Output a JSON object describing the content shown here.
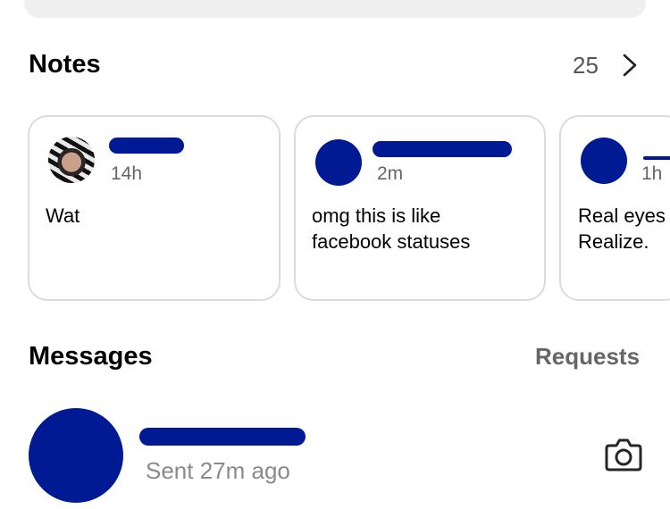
{
  "notes": {
    "title": "Notes",
    "count": "25",
    "cards": [
      {
        "time": "14h",
        "text": "Wat"
      },
      {
        "time": "2m",
        "text": "omg this is like\nfacebook statuses"
      },
      {
        "time": "1h",
        "text": "Real eyes\nRealize."
      }
    ]
  },
  "messages": {
    "title": "Messages",
    "requests_label": "Requests",
    "threads": [
      {
        "status": "Sent 27m ago"
      }
    ]
  },
  "icons": {
    "notes_more": "chevron-right-icon",
    "thread_camera": "camera-icon"
  },
  "colors": {
    "redaction": "#001a94",
    "card_border": "#dbdbdb",
    "search_bg": "#efefef"
  }
}
